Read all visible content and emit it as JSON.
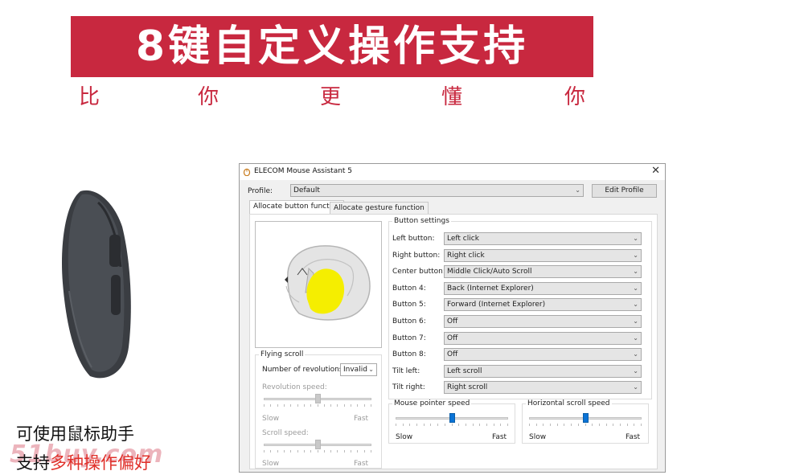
{
  "banner": {
    "title": "8键自定义操作支持",
    "subtitle_chars": [
      "比",
      "你",
      "更",
      "懂",
      "你"
    ]
  },
  "captions": {
    "line1": "可使用鼠标助手",
    "line2_prefix": "支持",
    "line2_highlight": "多种操作偏好",
    "watermark": "51buy.com"
  },
  "window": {
    "title": "ELECOM Mouse Assistant 5",
    "close": "✕",
    "profile_label": "Profile:",
    "profile_value": "Default",
    "edit_profile": "Edit Profile",
    "tabs": [
      "Allocate button function",
      "Allocate gesture function"
    ],
    "button_settings_title": "Button settings",
    "buttons": [
      {
        "label": "Left button:",
        "value": "Left click"
      },
      {
        "label": "Right button:",
        "value": "Right click"
      },
      {
        "label": "Center button:",
        "value": "Middle Click/Auto Scroll"
      },
      {
        "label": "Button 4:",
        "value": "Back (Internet Explorer)"
      },
      {
        "label": "Button 5:",
        "value": "Forward (Internet Explorer)"
      },
      {
        "label": "Button 6:",
        "value": "Off"
      },
      {
        "label": "Button 7:",
        "value": "Off"
      },
      {
        "label": "Button 8:",
        "value": "Off"
      },
      {
        "label": "Tilt left:",
        "value": "Left scroll"
      },
      {
        "label": "Tilt right:",
        "value": "Right scroll"
      }
    ],
    "flying_scroll": {
      "title": "Flying scroll",
      "revolutions_label": "Number of revolutions:",
      "revolutions_value": "Invalid",
      "revolution_speed_label": "Revolution speed:",
      "scroll_speed_label": "Scroll speed:",
      "slow": "Slow",
      "fast": "Fast",
      "revolution_speed_level": 0.5,
      "scroll_speed_level": 0.5
    },
    "mouse_pointer_speed": {
      "title": "Mouse pointer speed",
      "slow": "Slow",
      "fast": "Fast",
      "level": 0.5
    },
    "horizontal_scroll_speed": {
      "title": "Horizontal scroll speed",
      "slow": "Slow",
      "fast": "Fast",
      "level": 0.5
    },
    "highlight_color": "#f5ee00",
    "slider_color": "#0b73d6"
  }
}
